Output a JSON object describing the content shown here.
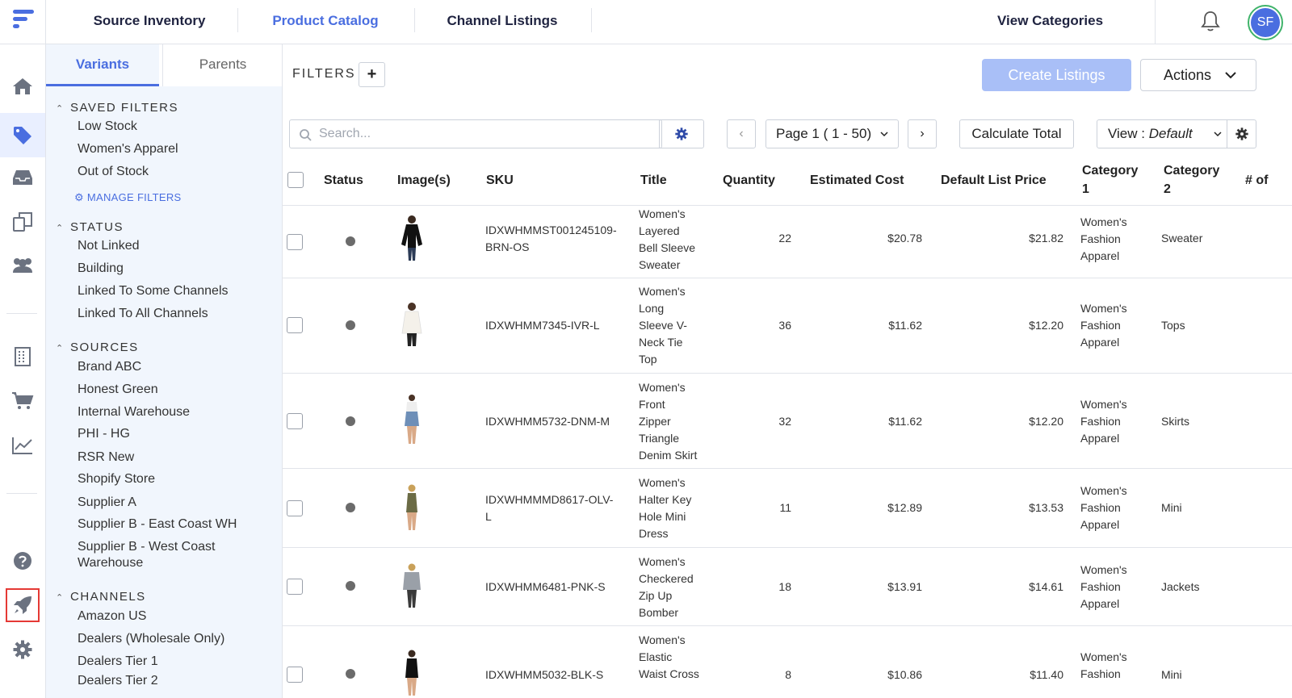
{
  "topnav": {
    "tabs": [
      {
        "label": "Source Inventory"
      },
      {
        "label": "Product Catalog"
      },
      {
        "label": "Channel Listings"
      }
    ],
    "view_categories": "View Categories",
    "avatar_initials": "SF"
  },
  "sidebar_tabs": {
    "variants": "Variants",
    "parents": "Parents"
  },
  "filters": {
    "saved_filters": {
      "title": "SAVED FILTERS",
      "items": [
        "Low Stock",
        "Women's Apparel",
        "Out of Stock"
      ],
      "manage": "MANAGE FILTERS"
    },
    "status": {
      "title": "STATUS",
      "items": [
        "Not Linked",
        "Building",
        "Linked To Some Channels",
        "Linked To All Channels"
      ]
    },
    "sources": {
      "title": "SOURCES",
      "items": [
        "Brand ABC",
        "Honest Green",
        "Internal Warehouse",
        "PHI - HG",
        "RSR New",
        "Shopify Store",
        "Supplier A",
        "Supplier B - East Coast WH",
        "Supplier B - West Coast",
        "Warehouse"
      ]
    },
    "channels": {
      "title": "CHANNELS",
      "items": [
        "Amazon US",
        "Dealers (Wholesale Only)",
        "Dealers Tier 1",
        "Dealers Tier 2"
      ]
    }
  },
  "toolbar": {
    "filters_label": "FILTERS",
    "create_listings": "Create Listings",
    "actions": "Actions",
    "search_placeholder": "Search...",
    "page_label": "Page 1 ( 1 - 50)",
    "calculate_total": "Calculate Total",
    "view_prefix": "View :",
    "view_value": "Default"
  },
  "table": {
    "headers": {
      "status": "Status",
      "images": "Image(s)",
      "sku": "SKU",
      "title": "Title",
      "quantity": "Quantity",
      "estimated_cost": "Estimated Cost",
      "default_list_price": "Default List Price",
      "category1_a": "Category",
      "category1_b": "1",
      "category2_a": "Category",
      "category2_b": "2",
      "more": "# of"
    },
    "rows": [
      {
        "sku1": "IDXWHMMST001245109-",
        "sku2": "BRN-OS",
        "title": [
          "Women's",
          "Layered",
          "Bell Sleeve",
          "Sweater"
        ],
        "qty": "22",
        "cost": "$20.78",
        "price": "$21.82",
        "cat1": [
          "Women's",
          "Fashion",
          "Apparel"
        ],
        "cat2": "Sweater"
      },
      {
        "sku1": "IDXWHMM7345-IVR-L",
        "sku2": "",
        "title": [
          "Women's",
          "Long",
          "Sleeve V-",
          "Neck Tie",
          "Top"
        ],
        "qty": "36",
        "cost": "$11.62",
        "price": "$12.20",
        "cat1": [
          "Women's",
          "Fashion",
          "Apparel"
        ],
        "cat2": "Tops"
      },
      {
        "sku1": "IDXWHMM5732-DNM-M",
        "sku2": "",
        "title": [
          "Women's",
          "Front",
          "Zipper",
          "Triangle",
          "Denim Skirt"
        ],
        "qty": "32",
        "cost": "$11.62",
        "price": "$12.20",
        "cat1": [
          "Women's",
          "Fashion",
          "Apparel"
        ],
        "cat2": "Skirts"
      },
      {
        "sku1": "IDXWHMMMD8617-OLV-",
        "sku2": "L",
        "title": [
          "Women's",
          "Halter Key",
          "Hole Mini",
          "Dress"
        ],
        "qty": "11",
        "cost": "$12.89",
        "price": "$13.53",
        "cat1": [
          "Women's",
          "Fashion",
          "Apparel"
        ],
        "cat2": "Mini"
      },
      {
        "sku1": "IDXWHMM6481-PNK-S",
        "sku2": "",
        "title": [
          "Women's",
          "Checkered",
          "Zip Up",
          "Bomber"
        ],
        "qty": "18",
        "cost": "$13.91",
        "price": "$14.61",
        "cat1": [
          "Women's",
          "Fashion",
          "Apparel"
        ],
        "cat2": "Jackets"
      },
      {
        "sku1": "IDXWHMM5032-BLK-S",
        "sku2": "",
        "title": [
          "Women's",
          "Elastic",
          "Waist Cross"
        ],
        "qty": "8",
        "cost": "$10.86",
        "price": "$11.40",
        "cat1": [
          "Women's",
          "Fashion"
        ],
        "cat2": "Mini"
      }
    ]
  },
  "colors": {
    "accent": "#4a6ee0",
    "create_disabled": "#a9bff7",
    "sidebar_bg": "#f1f6fd",
    "rail_highlight": "#e53935"
  }
}
